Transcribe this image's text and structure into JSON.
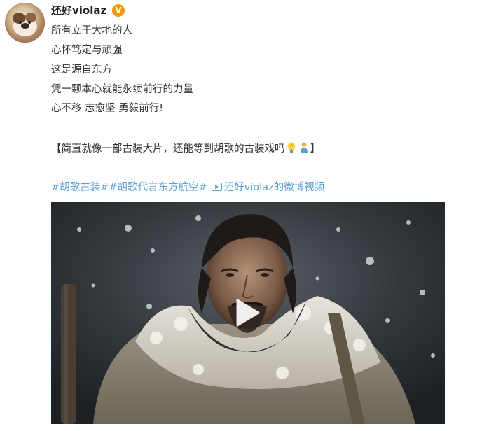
{
  "post": {
    "username": "还好violaz",
    "verified_badge": "V",
    "verified_color": "#f09a08",
    "lines": [
      "所有立于大地的人",
      "心怀笃定与顽强",
      "这是源自东方",
      "凭一颗本心就能永续前行的力量",
      "心不移 志愈坚 勇毅前行!"
    ],
    "bracket_open": "【简直就像一部古装大片，还能等到胡歌的古装戏吗",
    "bracket_emojis": [
      "lightbulb-emoji",
      "person-emoji"
    ],
    "bracket_close": "】",
    "hashtags": [
      "#胡歌古装#",
      "#胡歌代言东方航空#"
    ],
    "video_link_label": "还好violaz的微博视频",
    "link_color": "#5aa0d2"
  },
  "video": {
    "description_icon": "play-icon"
  }
}
